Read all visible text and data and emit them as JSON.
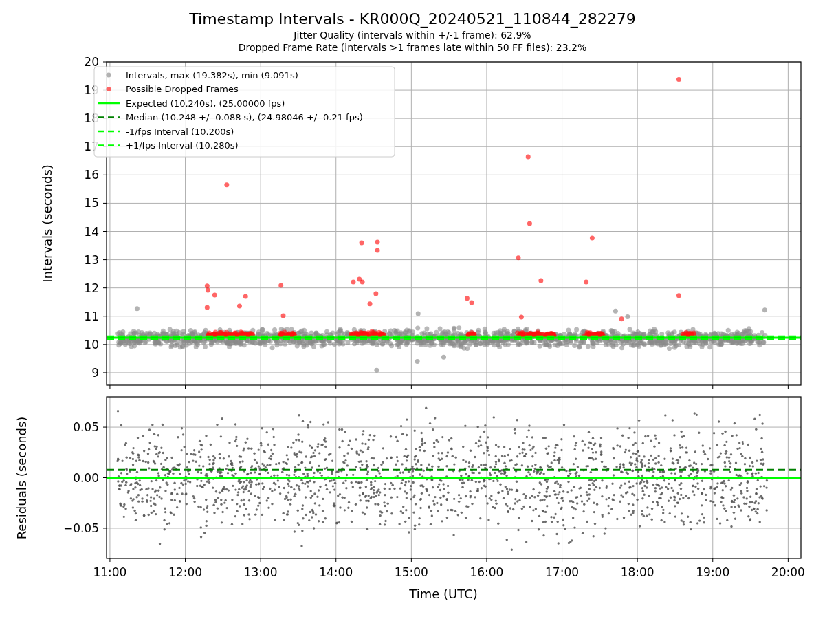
{
  "title": "Timestamp Intervals - KR000Q_20240521_110844_282279",
  "subtitles": [
    "Jitter Quality (intervals within +/-1 frame): 62.9%",
    "Dropped Frame Rate (intervals >1 frames late within 50 FF files): 23.2%"
  ],
  "top_chart": {
    "chart_data": {
      "type": "scatter",
      "ylabel": "Intervals (seconds)",
      "xlim": [
        10.955,
        20.17
      ],
      "ylim": [
        8.56,
        20
      ],
      "grid": true,
      "legend": true,
      "yticks": [
        {
          "value": 9,
          "label": "9"
        },
        {
          "value": 10,
          "label": "10"
        },
        {
          "value": 11,
          "label": "11"
        },
        {
          "value": 12,
          "label": "12"
        },
        {
          "value": 13,
          "label": "13"
        },
        {
          "value": 14,
          "label": "14"
        },
        {
          "value": 15,
          "label": "15"
        },
        {
          "value": 16,
          "label": "16"
        },
        {
          "value": 17,
          "label": "17"
        },
        {
          "value": 18,
          "label": "18"
        },
        {
          "value": 19,
          "label": "19"
        },
        {
          "value": 20,
          "label": "20"
        }
      ],
      "series": [
        {
          "name": "Intervals, max (19.382s), min (9.091s)",
          "color": "#808080",
          "x": [
            11.36,
            14.54,
            19.69,
            17.71,
            15.09,
            17.87,
            15.43,
            15.08
          ],
          "values": [
            11.27,
            9.091,
            11.22,
            11.18,
            11.09,
            10.98,
            9.55,
            9.4
          ]
        },
        {
          "name": "Possible Dropped Frames",
          "color": "#ff0000",
          "x": [
            12.29,
            12.3,
            12.39,
            12.29,
            12.55,
            12.72,
            12.8,
            13.27,
            13.3,
            14.23,
            14.31,
            14.35,
            14.34,
            14.55,
            14.55,
            14.53,
            14.45,
            15.74,
            15.8,
            16.42,
            16.46,
            16.55,
            16.57,
            16.72,
            17.32,
            17.4,
            17.79,
            18.55,
            18.55
          ],
          "values": [
            12.07,
            11.92,
            11.75,
            11.31,
            15.65,
            11.36,
            11.7,
            12.09,
            11.02,
            12.21,
            12.31,
            12.21,
            13.6,
            13.62,
            13.33,
            11.8,
            11.44,
            11.63,
            11.48,
            13.07,
            10.97,
            16.64,
            14.28,
            12.26,
            12.21,
            13.77,
            10.9,
            19.382,
            11.73
          ]
        }
      ],
      "ref_lines": [
        {
          "axis": "y",
          "label": "Expected (10.240s), (25.00000 fps)",
          "color": "#00ff00",
          "line_style": "solid",
          "value": 10.24
        },
        {
          "axis": "y",
          "label": "Median (10.248 +/- 0.088 s), (24.98046 +/- 0.21 fps)",
          "color": "#008000",
          "line_style": "dashed",
          "value": 10.248
        },
        {
          "axis": "y",
          "label": "-1/fps Interval (10.200s)",
          "color": "#00ff00",
          "line_style": "dashed",
          "value": 10.2
        },
        {
          "axis": "y",
          "label": "+1/fps Interval (10.280s)",
          "color": "#00ff00",
          "line_style": "dashed",
          "value": 10.28
        }
      ]
    }
  },
  "bottom_chart": {
    "chart_data": {
      "type": "scatter",
      "xlabel": "Time (UTC)",
      "ylabel": "Residuals (seconds)",
      "xlim": [
        10.955,
        20.17
      ],
      "ylim": [
        -0.08,
        0.08
      ],
      "grid": true,
      "xticks": [
        {
          "value": 11,
          "label": "11:00"
        },
        {
          "value": 12,
          "label": "12:00"
        },
        {
          "value": 13,
          "label": "13:00"
        },
        {
          "value": 14,
          "label": "14:00"
        },
        {
          "value": 15,
          "label": "15:00"
        },
        {
          "value": 16,
          "label": "16:00"
        },
        {
          "value": 17,
          "label": "17:00"
        },
        {
          "value": 18,
          "label": "18:00"
        },
        {
          "value": 19,
          "label": "19:00"
        },
        {
          "value": 20,
          "label": "20:00"
        }
      ],
      "yticks": [
        {
          "value": -0.05,
          "label": "−0.05"
        },
        {
          "value": 0,
          "label": "0.00"
        },
        {
          "value": 0.05,
          "label": "0.05"
        }
      ],
      "ref_lines": [
        {
          "axis": "y",
          "color": "#008000",
          "line_style": "dashed",
          "value": 0.0077
        },
        {
          "axis": "y",
          "color": "#00ff00",
          "line_style": "solid",
          "value": 0
        }
      ]
    }
  }
}
